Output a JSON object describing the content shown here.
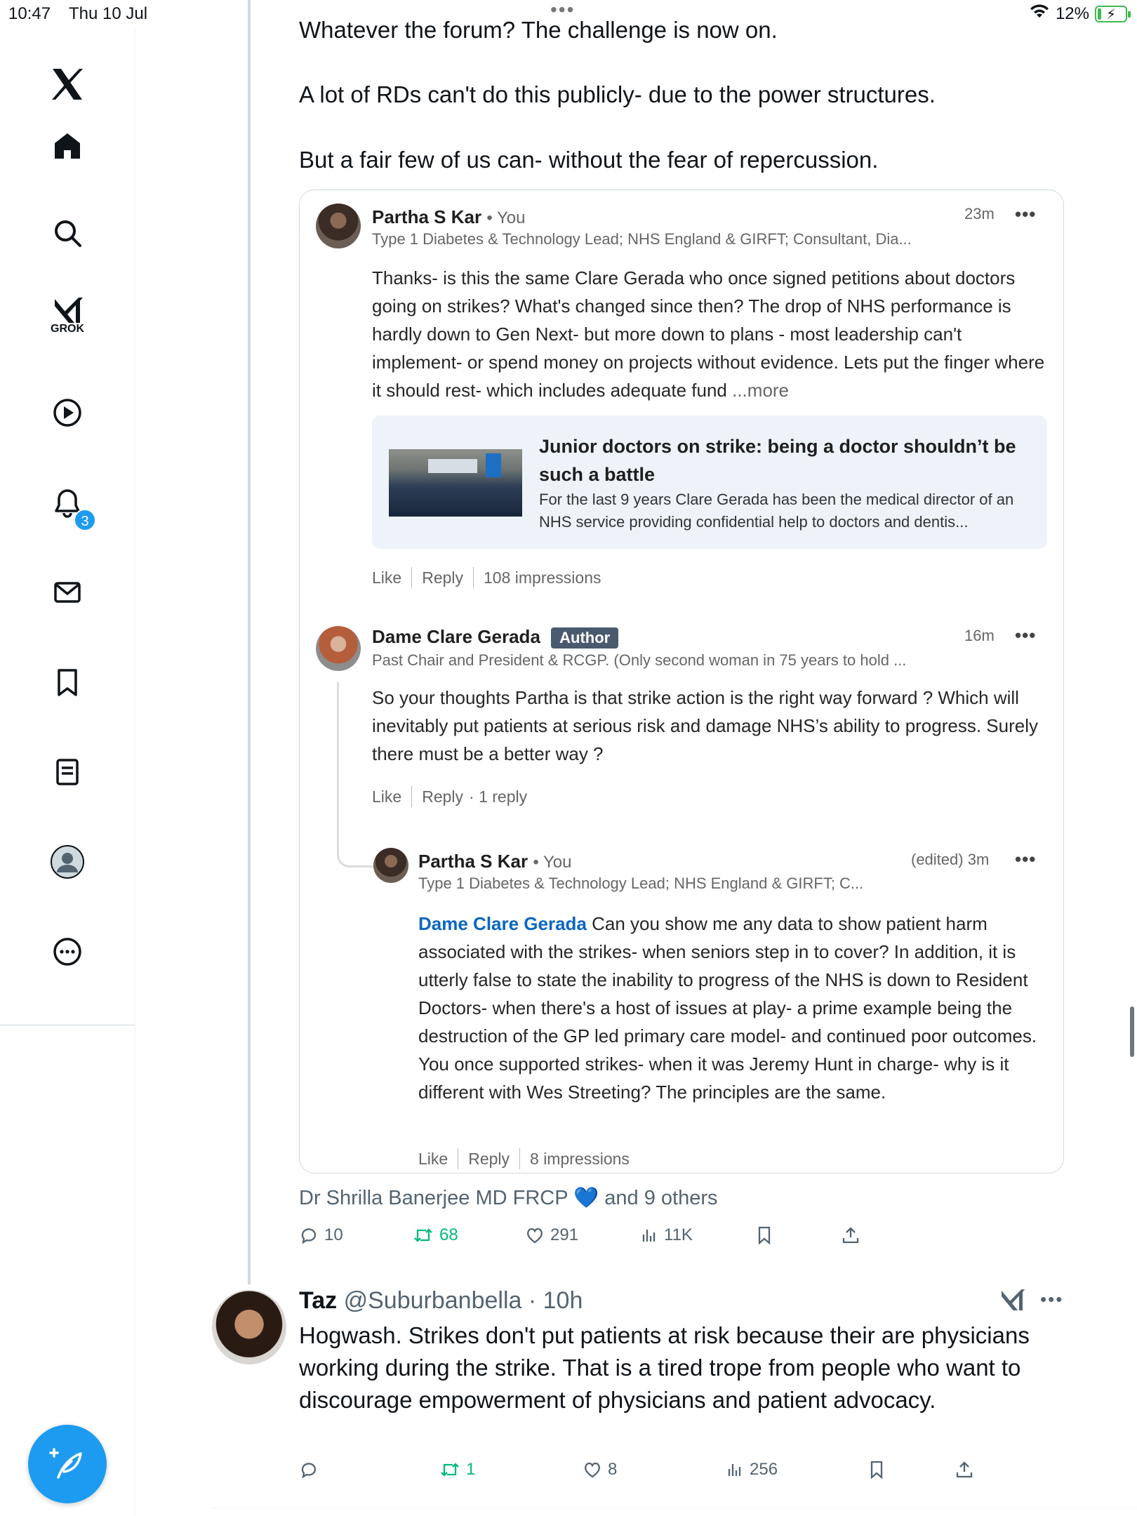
{
  "status_bar": {
    "time": "10:47",
    "date": "Thu 10 Jul",
    "battery": "12%",
    "battery_level": 0.12
  },
  "sidebar": {
    "grok_label": "GROK",
    "notifications_badge": "3"
  },
  "post": {
    "lines": [
      "Whatever the forum? The challenge is now on.",
      "A lot of RDs can't do this publicly- due to the power structures.",
      "But a fair few of us can- without the fear of repercussion."
    ],
    "quote": {
      "comment1": {
        "name": "Partha S Kar",
        "you": "• You",
        "headline": "Type 1 Diabetes & Technology Lead; NHS England & GIRFT; Consultant, Dia...",
        "time": "23m",
        "dots": "•••",
        "text": "Thanks- is this the same Clare Gerada who once signed petitions about doctors going on strikes? What's changed since then? The drop of NHS performance is hardly down to Gen Next- but more down to plans - most leadership can't implement- or spend money on projects without evidence. Lets put the finger where it should rest- which includes adequate fund",
        "more": "...more",
        "article": {
          "title": "Junior doctors on strike: being a doctor shouldn’t be such a battle",
          "description": "For the last 9 years Clare Gerada has been the medical director of an NHS service providing confidential help to doctors and dentis..."
        },
        "like": "Like",
        "reply": "Reply",
        "impressions": "108 impressions"
      },
      "comment2": {
        "name": "Dame Clare Gerada",
        "author_badge": "Author",
        "headline": "Past Chair and President & RCGP. (Only second woman in 75 years to hold ...",
        "time": "16m",
        "dots": "•••",
        "text": "So your thoughts Partha is that strike action is the right way forward ? Which will inevitably put patients at serious risk and damage NHS’s ability to progress. Surely there must be a better way ?",
        "like": "Like",
        "reply": "Reply",
        "replies": "· 1 reply"
      },
      "comment3": {
        "name": "Partha S Kar",
        "you": "• You",
        "headline": "Type 1 Diabetes & Technology Lead; NHS England & GIRFT; C...",
        "time": "(edited) 3m",
        "dots": "•••",
        "mention": "Dame Clare Gerada",
        "text": " Can you show me any data to show patient harm associated with the strikes- when seniors step in to cover? In addition, it is utterly false to state the inability to progress of the NHS is down to Resident Doctors- when there's a host of issues at play- a prime example being the destruction of the GP led primary care model- and continued poor outcomes. You once supported strikes- when it was Jeremy Hunt in charge- why is it different with Wes Streeting? The principles are the same.",
        "like": "Like",
        "reply": "Reply",
        "impressions": "8 impressions"
      }
    },
    "liked_by": {
      "name": "Dr Shrilla Banerjee MD FRCP",
      "emoji": "💙",
      "others": "and 9 others"
    },
    "actions": {
      "replies": "10",
      "reposts": "68",
      "likes": "291",
      "views": "11K"
    }
  },
  "reply_post": {
    "name": "Taz",
    "handle": "@Suburbanbella · 10h",
    "dots": "•••",
    "text": "Hogwash. Strikes don't put patients at risk because their are physicians working during the strike. That is a tired trope from people who want to discourage empowerment of physicians and patient advocacy.",
    "actions": {
      "replies": "",
      "reposts": "1",
      "likes": "8",
      "views": "256"
    }
  },
  "colors": {
    "accent": "#1d9bf0",
    "repost": "#00ba7c",
    "linkedin_link": "#0a66c2",
    "muted": "#536471"
  }
}
